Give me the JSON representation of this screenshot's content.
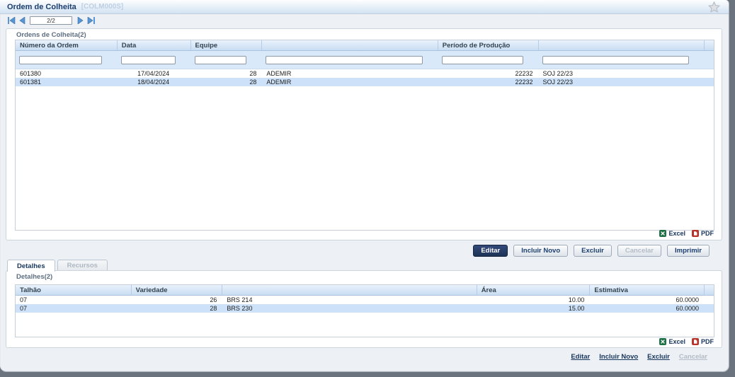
{
  "window": {
    "title": "Ordem de Colheita",
    "code": "[COLM000S]"
  },
  "toolbar": {
    "page_indicator": "2/2"
  },
  "orders": {
    "legend": "Ordens de Colheita(2)",
    "columns": [
      "Número da Ordem",
      "Data",
      "Equipe",
      "",
      "Período de Produção",
      ""
    ],
    "rows": [
      [
        "601380",
        "17/04/2024",
        "28",
        "ADEMIR",
        "22232",
        "SOJ 22/23"
      ],
      [
        "601381",
        "18/04/2024",
        "28",
        "ADEMIR",
        "22232",
        "SOJ 22/23"
      ]
    ],
    "selected_index": 1,
    "export": {
      "excel": "Excel",
      "pdf": "PDF"
    }
  },
  "actions": {
    "buttons": [
      {
        "label": "Editar"
      },
      {
        "label": "Incluir Novo"
      },
      {
        "label": "Excluir"
      },
      {
        "label": "Cancelar",
        "disabled": true
      },
      {
        "label": "Imprimir"
      }
    ]
  },
  "tabs": [
    {
      "label": "Detalhes",
      "active": true
    },
    {
      "label": "Recursos",
      "disabled": true
    }
  ],
  "details": {
    "legend": "Detalhes(2)",
    "columns": [
      "Talhão",
      "Variedade",
      "",
      "Área",
      "Estimativa"
    ],
    "rows": [
      [
        "07",
        "26",
        "BRS 214",
        "10.00",
        "60.0000"
      ],
      [
        "07",
        "28",
        "BRS 230",
        "15.00",
        "60.0000"
      ]
    ],
    "selected_index": 1,
    "export": {
      "excel": "Excel",
      "pdf": "PDF"
    }
  },
  "footer_links": [
    {
      "label": "Editar"
    },
    {
      "label": "Incluir Novo"
    },
    {
      "label": "Excluir"
    },
    {
      "label": "Cancelar",
      "disabled": true
    }
  ],
  "colors": {
    "accent_navy": "#17365d",
    "selected_row": "#cde2f8",
    "header_blue": "#c9ddf2",
    "excel_green": "#1e7145",
    "pdf_red": "#b8342a",
    "chrome_dark": "#6b747e"
  }
}
